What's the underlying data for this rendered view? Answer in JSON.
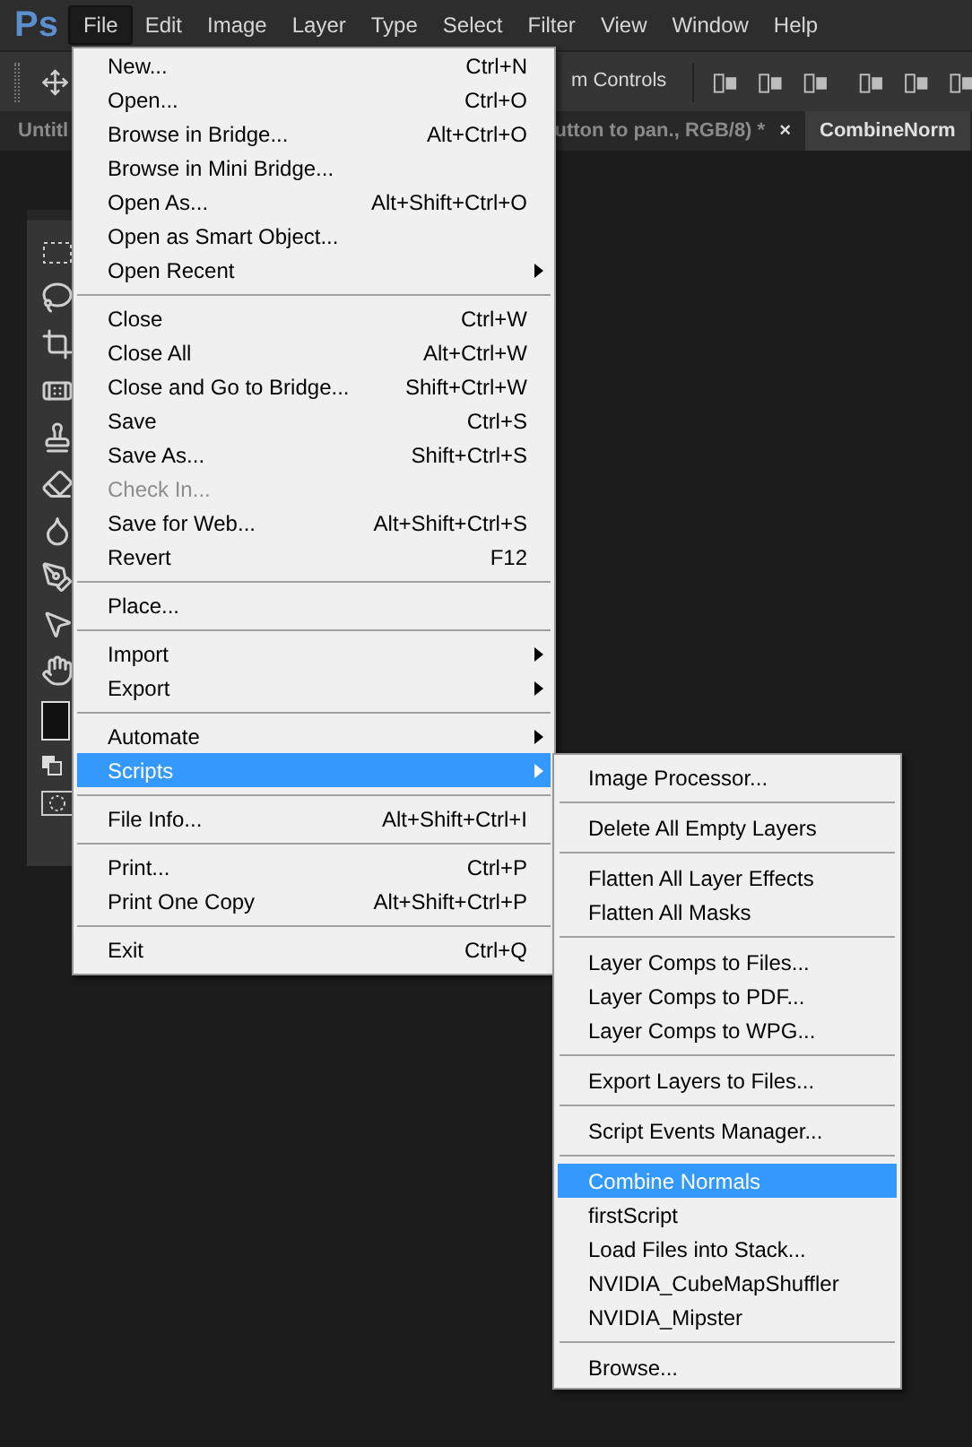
{
  "app_logo": "Ps",
  "menubar": [
    {
      "label": "File",
      "selected": true
    },
    {
      "label": "Edit",
      "selected": false
    },
    {
      "label": "Image",
      "selected": false
    },
    {
      "label": "Layer",
      "selected": false
    },
    {
      "label": "Type",
      "selected": false
    },
    {
      "label": "Select",
      "selected": false
    },
    {
      "label": "Filter",
      "selected": false
    },
    {
      "label": "View",
      "selected": false
    },
    {
      "label": "Window",
      "selected": false
    },
    {
      "label": "Help",
      "selected": false
    }
  ],
  "options_bar": {
    "label": "m Controls"
  },
  "doc_tabs": [
    {
      "label": "Untitl",
      "selected": false
    },
    {
      "label": "utton to pan., RGB/8) *",
      "selected": false,
      "close": "×"
    },
    {
      "label": "CombineNorm",
      "selected": true
    }
  ],
  "file_menu": [
    [
      {
        "label": "New...",
        "shortcut": "Ctrl+N",
        "submenu": false,
        "disabled": false,
        "selected": false
      },
      {
        "label": "Open...",
        "shortcut": "Ctrl+O",
        "submenu": false,
        "disabled": false,
        "selected": false
      },
      {
        "label": "Browse in Bridge...",
        "shortcut": "Alt+Ctrl+O",
        "submenu": false,
        "disabled": false,
        "selected": false
      },
      {
        "label": "Browse in Mini Bridge...",
        "submenu": false,
        "disabled": false,
        "selected": false
      },
      {
        "label": "Open As...",
        "shortcut": "Alt+Shift+Ctrl+O",
        "submenu": false,
        "disabled": false,
        "selected": false
      },
      {
        "label": "Open as Smart Object...",
        "submenu": false,
        "disabled": false,
        "selected": false
      },
      {
        "label": "Open Recent",
        "submenu": true,
        "disabled": false,
        "selected": false
      }
    ],
    [
      {
        "label": "Close",
        "shortcut": "Ctrl+W",
        "submenu": false,
        "disabled": false,
        "selected": false
      },
      {
        "label": "Close All",
        "shortcut": "Alt+Ctrl+W",
        "submenu": false,
        "disabled": false,
        "selected": false
      },
      {
        "label": "Close and Go to Bridge...",
        "shortcut": "Shift+Ctrl+W",
        "submenu": false,
        "disabled": false,
        "selected": false
      },
      {
        "label": "Save",
        "shortcut": "Ctrl+S",
        "submenu": false,
        "disabled": false,
        "selected": false
      },
      {
        "label": "Save As...",
        "shortcut": "Shift+Ctrl+S",
        "submenu": false,
        "disabled": false,
        "selected": false
      },
      {
        "label": "Check In...",
        "submenu": false,
        "disabled": true,
        "selected": false
      },
      {
        "label": "Save for Web...",
        "shortcut": "Alt+Shift+Ctrl+S",
        "submenu": false,
        "disabled": false,
        "selected": false
      },
      {
        "label": "Revert",
        "shortcut": "F12",
        "submenu": false,
        "disabled": false,
        "selected": false
      }
    ],
    [
      {
        "label": "Place...",
        "submenu": false,
        "disabled": false,
        "selected": false
      }
    ],
    [
      {
        "label": "Import",
        "submenu": true,
        "disabled": false,
        "selected": false
      },
      {
        "label": "Export",
        "submenu": true,
        "disabled": false,
        "selected": false
      }
    ],
    [
      {
        "label": "Automate",
        "submenu": true,
        "disabled": false,
        "selected": false
      },
      {
        "label": "Scripts",
        "submenu": true,
        "disabled": false,
        "selected": true
      }
    ],
    [
      {
        "label": "File Info...",
        "shortcut": "Alt+Shift+Ctrl+I",
        "submenu": false,
        "disabled": false,
        "selected": false
      }
    ],
    [
      {
        "label": "Print...",
        "shortcut": "Ctrl+P",
        "submenu": false,
        "disabled": false,
        "selected": false
      },
      {
        "label": "Print One Copy",
        "shortcut": "Alt+Shift+Ctrl+P",
        "submenu": false,
        "disabled": false,
        "selected": false
      }
    ],
    [
      {
        "label": "Exit",
        "shortcut": "Ctrl+Q",
        "submenu": false,
        "disabled": false,
        "selected": false
      }
    ]
  ],
  "scripts_menu": [
    [
      {
        "label": "Image Processor...",
        "selected": false
      }
    ],
    [
      {
        "label": "Delete All Empty Layers",
        "selected": false
      }
    ],
    [
      {
        "label": "Flatten All Layer Effects",
        "selected": false
      },
      {
        "label": "Flatten All Masks",
        "selected": false
      }
    ],
    [
      {
        "label": "Layer Comps to Files...",
        "selected": false
      },
      {
        "label": "Layer Comps to PDF...",
        "selected": false
      },
      {
        "label": "Layer Comps to WPG...",
        "selected": false
      }
    ],
    [
      {
        "label": "Export Layers to Files...",
        "selected": false
      }
    ],
    [
      {
        "label": "Script Events Manager...",
        "selected": false
      }
    ],
    [
      {
        "label": "Combine Normals",
        "selected": true
      },
      {
        "label": "firstScript",
        "selected": false
      },
      {
        "label": "Load Files into Stack...",
        "selected": false
      },
      {
        "label": "NVIDIA_CubeMapShuffler",
        "selected": false
      },
      {
        "label": "NVIDIA_Mipster",
        "selected": false
      }
    ],
    [
      {
        "label": "Browse...",
        "selected": false
      }
    ]
  ]
}
